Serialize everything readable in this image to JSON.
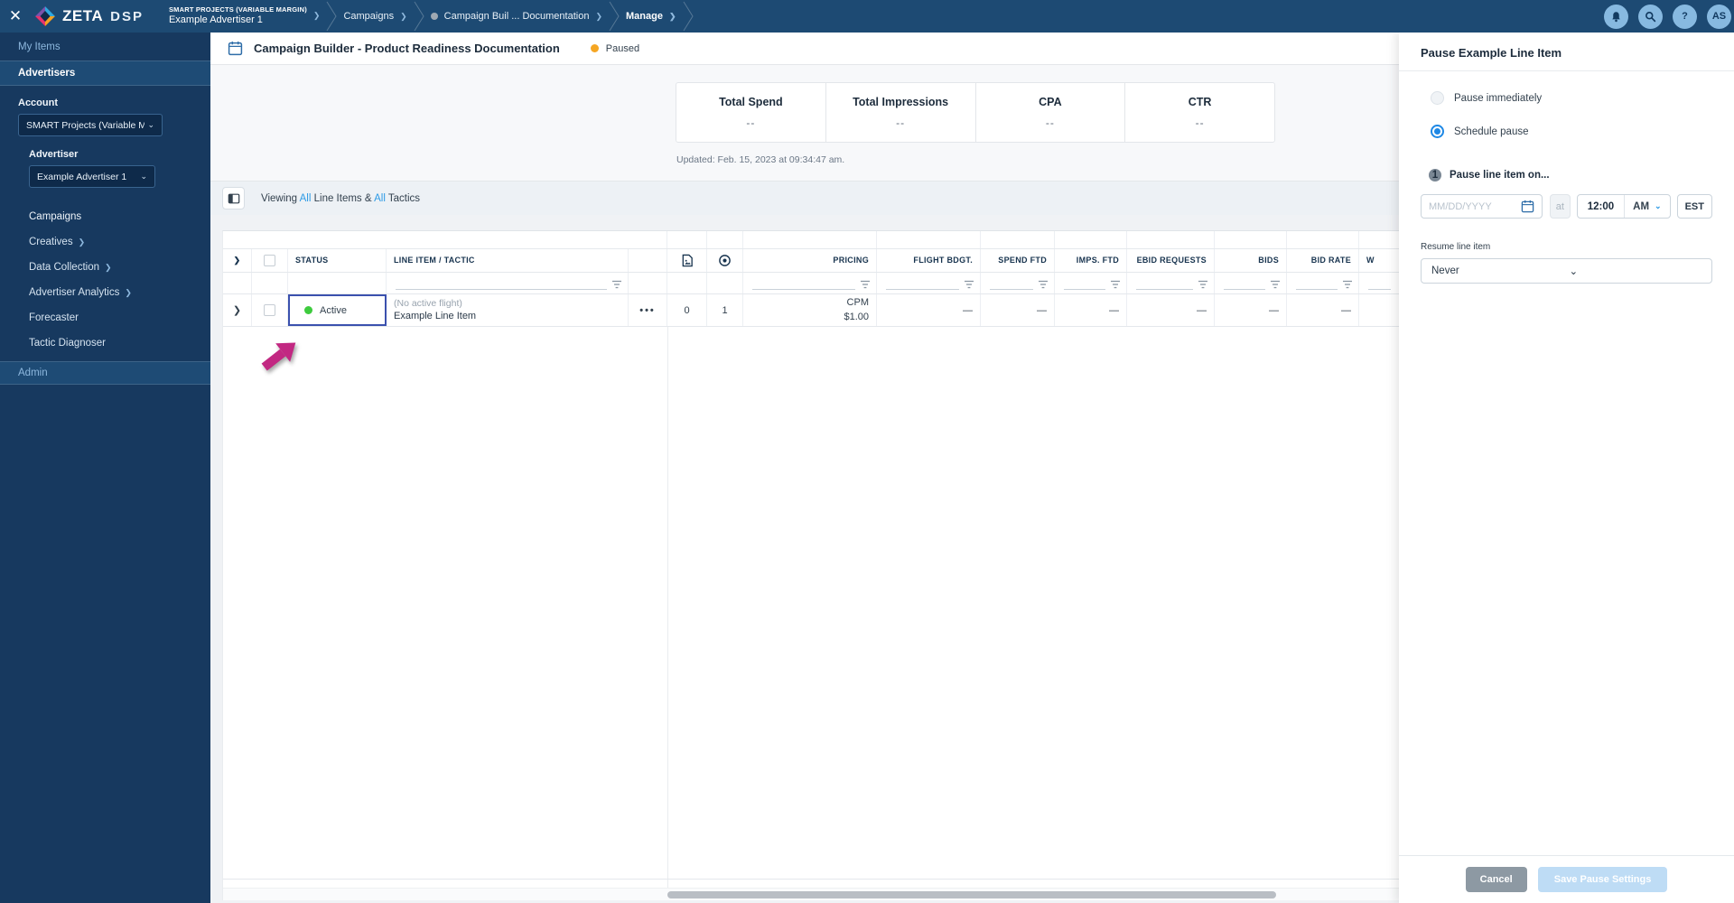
{
  "topbar": {
    "logo_zeta": "ZETA",
    "logo_dsp": "DSP",
    "close_label": "✕",
    "breadcrumbs": {
      "crumb1_eyebrow": "SMART PROJECTS (VARIABLE MARGIN)",
      "crumb1_label": "Example Advertiser 1",
      "crumb2_label": "Campaigns",
      "crumb3_label": "Campaign Buil ... Documentation",
      "crumb4_label": "Manage"
    },
    "icons": [
      "bell-icon",
      "search-icon",
      "help-icon",
      "avatar"
    ],
    "help_glyph": "?",
    "user_initials": "AS"
  },
  "sidebar": {
    "my_items": "My Items",
    "advertisers": "Advertisers",
    "account_label": "Account",
    "account_value": "SMART Projects (Variable M...",
    "advertiser_label": "Advertiser",
    "advertiser_value": "Example Advertiser 1",
    "items": [
      {
        "label": "Campaigns"
      },
      {
        "label": "Creatives"
      },
      {
        "label": "Data Collection"
      },
      {
        "label": "Advertiser Analytics"
      },
      {
        "label": "Forecaster"
      },
      {
        "label": "Tactic Diagnoser"
      }
    ],
    "admin": "Admin"
  },
  "header": {
    "title": "Campaign Builder - Product Readiness Documentation",
    "status": "Paused"
  },
  "stats": {
    "metrics": [
      {
        "label": "Total Spend",
        "value": "--"
      },
      {
        "label": "Total Impressions",
        "value": "--"
      },
      {
        "label": "CPA",
        "value": "--"
      },
      {
        "label": "CTR",
        "value": "--"
      }
    ],
    "updated": "Updated: Feb. 15, 2023 at 09:34:47 am."
  },
  "viewing_bar": {
    "prefix": "Viewing ",
    "all1": "All",
    "mid": " Line Items & ",
    "all2": "All",
    "suffix": " Tactics"
  },
  "table": {
    "columns": [
      "STATUS",
      "LINE ITEM / TACTIC",
      "PRICING",
      "FLIGHT BDGT.",
      "SPEND FTD",
      "IMPS. FTD",
      "EBID REQUESTS",
      "BIDS",
      "BID RATE",
      "W"
    ],
    "icon_columns": [
      "creative-file-icon",
      "tactic-target-icon"
    ],
    "row": {
      "status": "Active",
      "flight_note": "(No active flight)",
      "name": "Example Line Item",
      "menu": "•••",
      "creatives_count": "0",
      "tactics_count": "1",
      "pricing_type": "CPM",
      "pricing_value": "$1.00",
      "flight_bdgt": "—",
      "spend_ftd": "—",
      "imps_ftd": "—",
      "ebid_requests": "—",
      "bids": "—",
      "bid_rate": "—"
    }
  },
  "panel": {
    "title": "Pause Example Line Item",
    "radio_immediate": "Pause immediately",
    "radio_schedule": "Schedule pause",
    "step_number": "1",
    "step_label": "Pause line item on...",
    "date_placeholder": "MM/DD/YYYY",
    "at_label": "at",
    "time_value": "12:00",
    "meridiem": "AM",
    "timezone": "EST",
    "resume_label": "Resume line item",
    "resume_value": "Never",
    "cancel_label": "Cancel",
    "save_label": "Save Pause Settings"
  },
  "colors": {
    "topbar_bg": "#1d4a73",
    "sidebar_bg": "#17395f",
    "accent_blue": "#2e9be6",
    "active_green": "#3ecb3e",
    "paused_orange": "#f5a623",
    "arrow_magenta": "#c22882",
    "focus_indigo": "#3b51ae"
  }
}
